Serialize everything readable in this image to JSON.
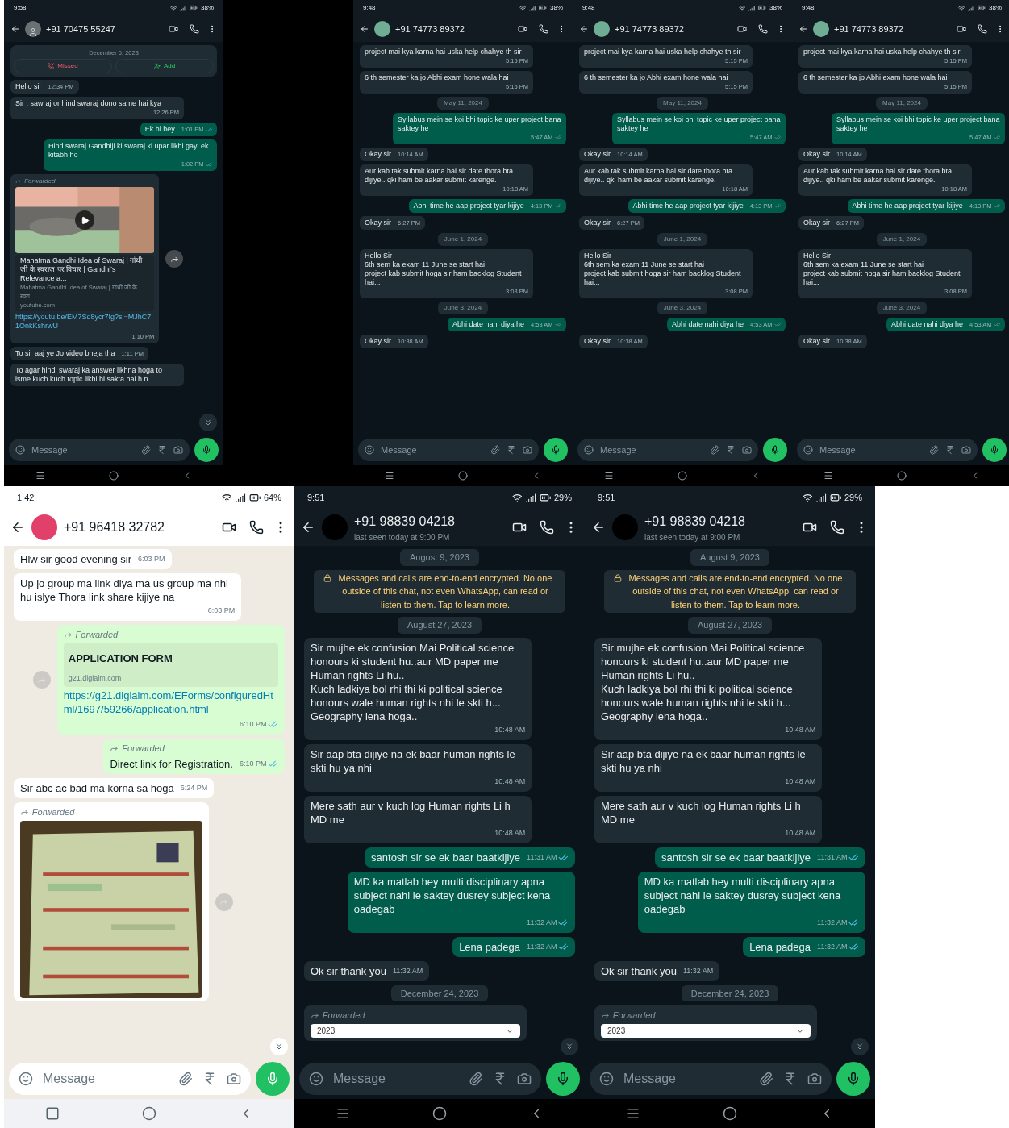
{
  "top_row": [
    {
      "dark_mode": true,
      "status_time": "9:58",
      "battery": "38%",
      "avatar": {
        "kind": "silhouette"
      },
      "contact": {
        "name": "+91 70475 55247"
      },
      "scroll_button": true,
      "composer": {
        "placeholder": "Message"
      },
      "messages": [
        {
          "kind": "call_card",
          "date": "December 6, 2023",
          "actions": [
            {
              "kind": "missed",
              "label": "Missed"
            },
            {
              "kind": "add",
              "label": "Add"
            }
          ]
        },
        {
          "kind": "message",
          "outgoing": false,
          "text": "Hello sir",
          "time": "12:34 PM"
        },
        {
          "kind": "message",
          "outgoing": false,
          "text": "Sir , sawraj or hind swaraj  dono same hai kya",
          "time": "12:26 PM"
        },
        {
          "kind": "message",
          "outgoing": true,
          "text": "Ek hi hey",
          "time": "1:01 PM",
          "read": true
        },
        {
          "kind": "message",
          "outgoing": true,
          "text": "Hind swaraj Gandhiji ki swaraj ki upar likhi gayi ek kitabh ho",
          "time": "1:02 PM",
          "read": true
        },
        {
          "kind": "message",
          "outgoing": false,
          "forwarded": "Forwarded",
          "attachment": {
            "kind": "video"
          },
          "share_button": true,
          "preview": {
            "title": "Mahatma Gandhi Idea of Swaraj | गांधी जी के स्वराज पर विचार | Gandhi's Relevance a...",
            "description": "Mahatma Gandhi Idea of Swaraj | गांधी जी के स्वरा...",
            "domain": "youtube.com"
          },
          "link": "https://youtu.be/EM7Sq8ycr7Ig?si=MJhC71OnkKshrwU",
          "time": "1:10 PM"
        },
        {
          "kind": "message",
          "outgoing": false,
          "text": "To sir aaj ye Jo video bheja tha",
          "time": "1:11 PM"
        },
        {
          "kind": "message",
          "outgoing": false,
          "text": "To agar hindi swaraj ka answer likhna hoga to isme kuch kuch topic likhi hi sakta hai h n"
        }
      ]
    },
    {
      "dark_mode": true,
      "status_time": "9:48",
      "battery": "38%",
      "avatar": {
        "kind": "plain",
        "color": "#6fae94"
      },
      "contact": {
        "name": "+91 74773 89372"
      },
      "scroll_button": false,
      "composer": {
        "placeholder": "Message"
      },
      "messages": [
        {
          "kind": "message",
          "outgoing": false,
          "text": "project mai kya  karna hai uska help chahye th sir",
          "time": "5:15 PM"
        },
        {
          "kind": "message",
          "outgoing": false,
          "text": "6 th semester ka jo Abhi exam hone wala hai",
          "time": "5:15 PM"
        },
        {
          "kind": "date",
          "text": "May 11, 2024"
        },
        {
          "kind": "message",
          "outgoing": true,
          "text": "Syllabus mein se koi bhi topic ke uper project bana saktey he",
          "time": "5:47 AM",
          "read": false
        },
        {
          "kind": "message",
          "outgoing": false,
          "text": "Okay sir",
          "time": "10:14 AM"
        },
        {
          "kind": "message",
          "outgoing": false,
          "text": "Aur kab tak submit karna hai sir date thora bta dijiye.. qki ham be aakar submit karenge.",
          "time": "10:18 AM"
        },
        {
          "kind": "message",
          "outgoing": true,
          "text": "Abhi time he aap project tyar kijiye",
          "time": "4:13 PM",
          "read": false
        },
        {
          "kind": "message",
          "outgoing": false,
          "text": "Okay sir",
          "time": "6:27 PM"
        },
        {
          "kind": "date",
          "text": "June 1, 2024"
        },
        {
          "kind": "message",
          "outgoing": false,
          "text": "Hello Sir\n6th sem ka exam 11 June se start hai\nproject kab submit hoga sir ham backlog Student hai...",
          "time": "3:08 PM"
        },
        {
          "kind": "date",
          "text": "June 3, 2024"
        },
        {
          "kind": "message",
          "outgoing": true,
          "text": "Abhi date nahi diya he",
          "time": "4:53 AM",
          "read": false
        },
        {
          "kind": "message",
          "outgoing": false,
          "text": "Okay sir",
          "time": "10:38 AM"
        }
      ]
    },
    {
      "dark_mode": true,
      "status_time": "9:48",
      "battery": "38%",
      "avatar": {
        "kind": "plain",
        "color": "#6fae94"
      },
      "contact": {
        "name": "+91 74773 89372"
      },
      "scroll_button": false,
      "composer": {
        "placeholder": "Message"
      },
      "messages": [
        {
          "kind": "message",
          "outgoing": false,
          "text": "project mai kya  karna hai uska help chahye th sir",
          "time": "5:15 PM"
        },
        {
          "kind": "message",
          "outgoing": false,
          "text": "6 th semester ka jo Abhi exam hone wala hai",
          "time": "5:15 PM"
        },
        {
          "kind": "date",
          "text": "May 11, 2024"
        },
        {
          "kind": "message",
          "outgoing": true,
          "text": "Syllabus mein se koi bhi topic ke uper project bana saktey he",
          "time": "5:47 AM",
          "read": false
        },
        {
          "kind": "message",
          "outgoing": false,
          "text": "Okay sir",
          "time": "10:14 AM"
        },
        {
          "kind": "message",
          "outgoing": false,
          "text": "Aur kab tak submit karna hai sir date thora bta dijiye.. qki ham be aakar submit karenge.",
          "time": "10:18 AM"
        },
        {
          "kind": "message",
          "outgoing": true,
          "text": "Abhi time he aap project tyar kijiye",
          "time": "4:13 PM",
          "read": false
        },
        {
          "kind": "message",
          "outgoing": false,
          "text": "Okay sir",
          "time": "6:27 PM"
        },
        {
          "kind": "date",
          "text": "June 1, 2024"
        },
        {
          "kind": "message",
          "outgoing": false,
          "text": "Hello Sir\n6th sem ka exam 11 June se start hai\nproject kab submit hoga sir ham backlog Student hai...",
          "time": "3:08 PM"
        },
        {
          "kind": "date",
          "text": "June 3, 2024"
        },
        {
          "kind": "message",
          "outgoing": true,
          "text": "Abhi date nahi diya he",
          "time": "4:53 AM",
          "read": false
        },
        {
          "kind": "message",
          "outgoing": false,
          "text": "Okay sir",
          "time": "10:38 AM"
        }
      ]
    },
    {
      "dark_mode": true,
      "status_time": "9:48",
      "battery": "38%",
      "avatar": {
        "kind": "plain",
        "color": "#6fae94"
      },
      "contact": {
        "name": "+91 74773 89372"
      },
      "scroll_button": false,
      "composer": {
        "placeholder": "Message"
      },
      "messages": [
        {
          "kind": "message",
          "outgoing": false,
          "text": "project mai kya  karna hai uska help chahye th sir",
          "time": "5:15 PM"
        },
        {
          "kind": "message",
          "outgoing": false,
          "text": "6 th semester ka jo Abhi exam hone wala hai",
          "time": "5:15 PM"
        },
        {
          "kind": "date",
          "text": "May 11, 2024"
        },
        {
          "kind": "message",
          "outgoing": true,
          "text": "Syllabus mein se koi bhi topic ke uper project bana saktey he",
          "time": "5:47 AM",
          "read": false
        },
        {
          "kind": "message",
          "outgoing": false,
          "text": "Okay sir",
          "time": "10:14 AM"
        },
        {
          "kind": "message",
          "outgoing": false,
          "text": "Aur kab tak submit karna hai sir date thora bta dijiye.. qki ham be aakar submit karenge.",
          "time": "10:18 AM"
        },
        {
          "kind": "message",
          "outgoing": true,
          "text": "Abhi time he aap project tyar kijiye",
          "time": "4:13 PM",
          "read": false
        },
        {
          "kind": "message",
          "outgoing": false,
          "text": "Okay sir",
          "time": "6:27 PM"
        },
        {
          "kind": "date",
          "text": "June 1, 2024"
        },
        {
          "kind": "message",
          "outgoing": false,
          "text": "Hello Sir\n6th sem ka exam 11 June se start hai\nproject kab submit hoga sir ham backlog Student hai...",
          "time": "3:08 PM"
        },
        {
          "kind": "date",
          "text": "June 3, 2024"
        },
        {
          "kind": "message",
          "outgoing": true,
          "text": "Abhi date nahi diya he",
          "time": "4:53 AM",
          "read": false
        },
        {
          "kind": "message",
          "outgoing": false,
          "text": "Okay sir",
          "time": "10:38 AM"
        }
      ]
    }
  ],
  "bottom_row": [
    {
      "dark_mode": false,
      "status_time": "1:42",
      "battery": "64%",
      "avatar": {
        "kind": "plain",
        "color": "#e0406a"
      },
      "contact": {
        "name": "+91 96418 32782"
      },
      "scroll_button": true,
      "composer": {
        "placeholder": "Message"
      },
      "messages": [
        {
          "kind": "message",
          "outgoing": false,
          "text": "Hlw sir good evening sir",
          "time": "6:03 PM"
        },
        {
          "kind": "message",
          "outgoing": false,
          "text": "Up jo group ma link diya ma us group ma nhi hu islye Thora link share kijiye na",
          "time": "6:03 PM"
        },
        {
          "kind": "message",
          "outgoing": true,
          "forwarded": "Forwarded",
          "share_button": true,
          "preview": {
            "title": "APPLICATION FORM",
            "domain": "g21.digialm.com"
          },
          "link": "https://g21.digialm.com/EForms/configuredHtml/1697/59266/application.html",
          "time": "6:10 PM",
          "read": true
        },
        {
          "kind": "message",
          "outgoing": true,
          "forwarded": "Forwarded",
          "text": "Direct link for Registration.",
          "time": "6:10 PM",
          "read": true
        },
        {
          "kind": "message",
          "outgoing": false,
          "text": "Sir abc ac bad ma korna sa hoga",
          "time": "6:24 PM"
        },
        {
          "kind": "message",
          "outgoing": false,
          "forwarded": "Forwarded",
          "share_button": true
        }
      ]
    },
    {
      "dark_mode": true,
      "status_time": "9:51",
      "battery": "29%",
      "avatar": {
        "kind": "plain",
        "color": "#000000"
      },
      "contact": {
        "name": "+91 98839 04218",
        "subtitle": "last seen today at 9:00 PM"
      },
      "scroll_button": true,
      "composer": {
        "placeholder": "Message"
      },
      "messages": [
        {
          "kind": "date",
          "text": "August 9, 2023"
        },
        {
          "kind": "system",
          "text": "Messages and calls are end-to-end encrypted. No one outside of this chat, not even WhatsApp, can read or listen to them. Tap to learn more."
        },
        {
          "kind": "date",
          "text": "August 27, 2023"
        },
        {
          "kind": "message",
          "outgoing": false,
          "text": "Sir mujhe ek confusion Mai Political science honours ki student hu..aur MD paper me Human rights Li hu..\nKuch ladkiya bol rhi thi ki political science honours wale human rights nhi le skti h...\nGeography lena hoga..",
          "time": "10:48 AM"
        },
        {
          "kind": "message",
          "outgoing": false,
          "text": "Sir aap bta dijiye na ek baar human rights le skti hu ya nhi",
          "time": "10:48 AM"
        },
        {
          "kind": "message",
          "outgoing": false,
          "text": "Mere sath aur v kuch log Human rights Li h MD me",
          "time": "10:48 AM"
        },
        {
          "kind": "message",
          "outgoing": true,
          "text": "santosh sir se ek baar baatkijiye",
          "time": "11:31 AM",
          "read": true
        },
        {
          "kind": "message",
          "outgoing": true,
          "text": "MD ka matlab hey multi disciplinary apna subject nahi le saktey dusrey subject kena oadegab",
          "time": "11:32 AM",
          "read": true
        },
        {
          "kind": "message",
          "outgoing": true,
          "text": "Lena padega",
          "time": "11:32 AM",
          "read": true
        },
        {
          "kind": "message",
          "outgoing": false,
          "text": "Ok sir thank you",
          "time": "11:32 AM"
        },
        {
          "kind": "date",
          "text": "December 24, 2023"
        },
        {
          "kind": "message",
          "outgoing": false,
          "forwarded": "Forwarded",
          "form_field": "2023"
        }
      ]
    },
    {
      "dark_mode": true,
      "status_time": "9:51",
      "battery": "29%",
      "avatar": {
        "kind": "plain",
        "color": "#000000"
      },
      "contact": {
        "name": "+91 98839 04218",
        "subtitle": "last seen today at 9:00 PM"
      },
      "scroll_button": true,
      "composer": {
        "placeholder": "Message"
      },
      "messages": [
        {
          "kind": "date",
          "text": "August 9, 2023"
        },
        {
          "kind": "system",
          "text": "Messages and calls are end-to-end encrypted. No one outside of this chat, not even WhatsApp, can read or listen to them. Tap to learn more."
        },
        {
          "kind": "date",
          "text": "August 27, 2023"
        },
        {
          "kind": "message",
          "outgoing": false,
          "text": "Sir mujhe ek confusion Mai Political science honours ki student hu..aur MD paper me Human rights Li hu..\nKuch ladkiya bol rhi thi ki political science honours wale human rights nhi le skti h...\nGeography lena hoga..",
          "time": "10:48 AM"
        },
        {
          "kind": "message",
          "outgoing": false,
          "text": "Sir aap bta dijiye na ek baar human rights le skti hu ya nhi",
          "time": "10:48 AM"
        },
        {
          "kind": "message",
          "outgoing": false,
          "text": "Mere sath aur v kuch log Human rights Li h MD me",
          "time": "10:48 AM"
        },
        {
          "kind": "message",
          "outgoing": true,
          "text": "santosh sir se ek baar baatkijiye",
          "time": "11:31 AM",
          "read": true
        },
        {
          "kind": "message",
          "outgoing": true,
          "text": "MD ka matlab hey multi disciplinary apna subject nahi le saktey dusrey subject kena oadegab",
          "time": "11:32 AM",
          "read": true
        },
        {
          "kind": "message",
          "outgoing": true,
          "text": "Lena padega",
          "time": "11:32 AM",
          "read": true
        },
        {
          "kind": "message",
          "outgoing": false,
          "text": "Ok sir thank you",
          "time": "11:32 AM"
        },
        {
          "kind": "date",
          "text": "December 24, 2023"
        },
        {
          "kind": "message",
          "outgoing": false,
          "forwarded": "Forwarded",
          "form_field": "2023"
        }
      ]
    }
  ]
}
